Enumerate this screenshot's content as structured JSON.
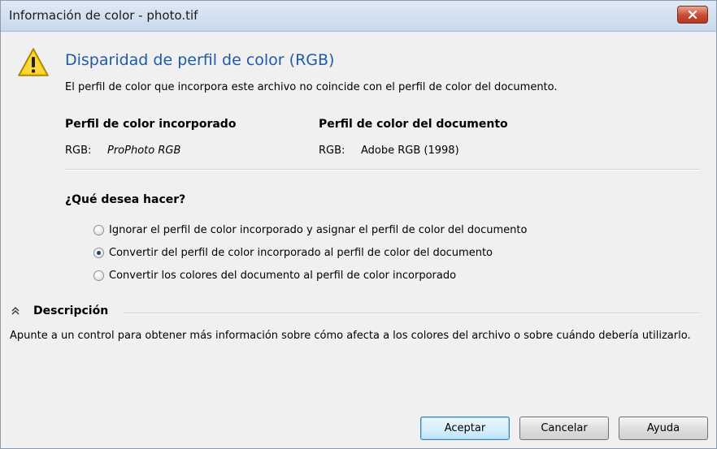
{
  "window": {
    "title": "Información de color - photo.tif"
  },
  "icons": {
    "warning": "warning-icon",
    "close": "close-icon",
    "collapse": "chevron-up-double-icon"
  },
  "colors": {
    "heading": "#1f5aa8",
    "close_button": "#c84a33",
    "warning_fill": "#f5c400"
  },
  "message": {
    "heading": "Disparidad de perfil de color (RGB)",
    "detail": "El perfil de color que incorpora este archivo no coincide con el perfil de color del documento."
  },
  "profiles": {
    "embedded": {
      "header": "Perfil de color incorporado",
      "prefix": "RGB:",
      "value": "ProPhoto RGB"
    },
    "document": {
      "header": "Perfil de color del documento",
      "prefix": "RGB:",
      "value": "Adobe RGB (1998)"
    }
  },
  "question": "¿Qué desea hacer?",
  "options": [
    {
      "label": "Ignorar el perfil de color incorporado y asignar el perfil de color del documento",
      "selected": false
    },
    {
      "label": "Convertir del perfil de color incorporado al perfil de color del documento",
      "selected": true
    },
    {
      "label": "Convertir los colores del documento al perfil de color incorporado",
      "selected": false
    }
  ],
  "description": {
    "title": "Descripción",
    "text": "Apunte a un control para obtener más información sobre cómo afecta a los colores del archivo o sobre cuándo debería utilizarlo.",
    "expanded": true
  },
  "buttons": {
    "ok": "Aceptar",
    "cancel": "Cancelar",
    "help": "Ayuda"
  }
}
